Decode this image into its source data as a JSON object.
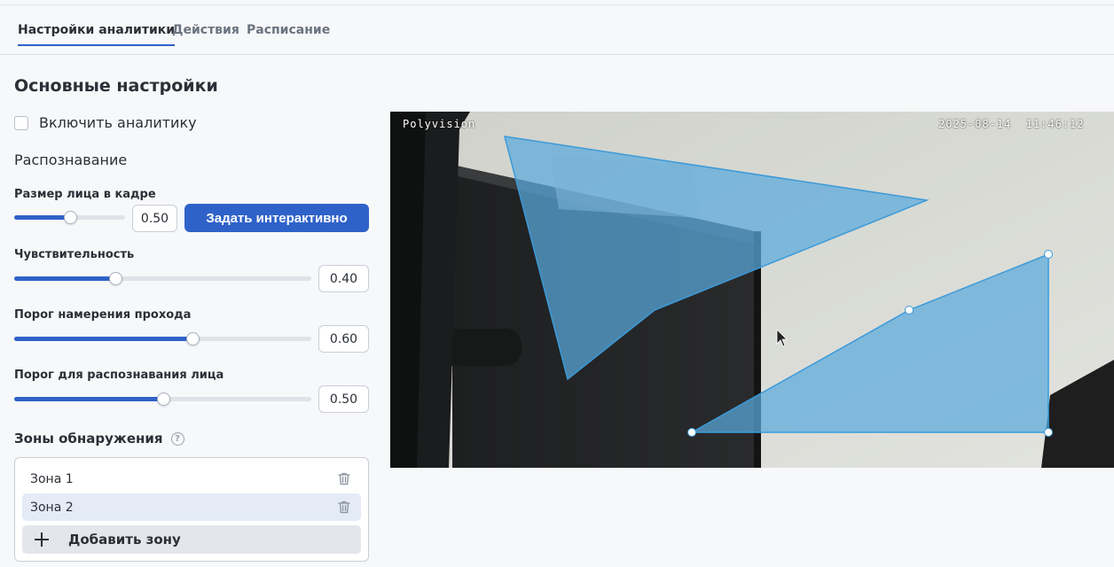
{
  "tabs": [
    {
      "label": "Настройки аналитики",
      "active": true
    },
    {
      "label": "Действия",
      "active": false
    },
    {
      "label": "Расписание",
      "active": false
    }
  ],
  "main": {
    "section_title": "Основные настройки",
    "enable_label": "Включить аналитику",
    "enable_checked": false,
    "recognition_title": "Распознавание",
    "set_interactive_label": "Задать интерактивно",
    "params": {
      "face_size": {
        "label": "Размер лица в кадре",
        "value": "0.50",
        "fraction": 0.5
      },
      "sensitivity": {
        "label": "Чувствительность",
        "value": "0.40",
        "fraction": 0.34
      },
      "pass_intent": {
        "label": "Порог намерения прохода",
        "value": "0.60",
        "fraction": 0.6
      },
      "face_threshold": {
        "label": "Порог для распознавания лица",
        "value": "0.50",
        "fraction": 0.5
      }
    },
    "zones_title": "Зоны обнаружения",
    "zones": [
      {
        "label": "Зона 1",
        "selected": false
      },
      {
        "label": "Зона 2",
        "selected": true
      }
    ],
    "add_zone_label": "Добавить зону"
  },
  "camera": {
    "brand": "Polyvision",
    "timestamp": "2025-08-14  11:46:12"
  },
  "colors": {
    "accent": "#2f62c9",
    "zone_fill": "#5aa9dd",
    "zone_stroke": "#3b9ad9"
  },
  "icons": [
    "help-icon",
    "trash-icon",
    "plus-icon",
    "cursor-icon"
  ]
}
